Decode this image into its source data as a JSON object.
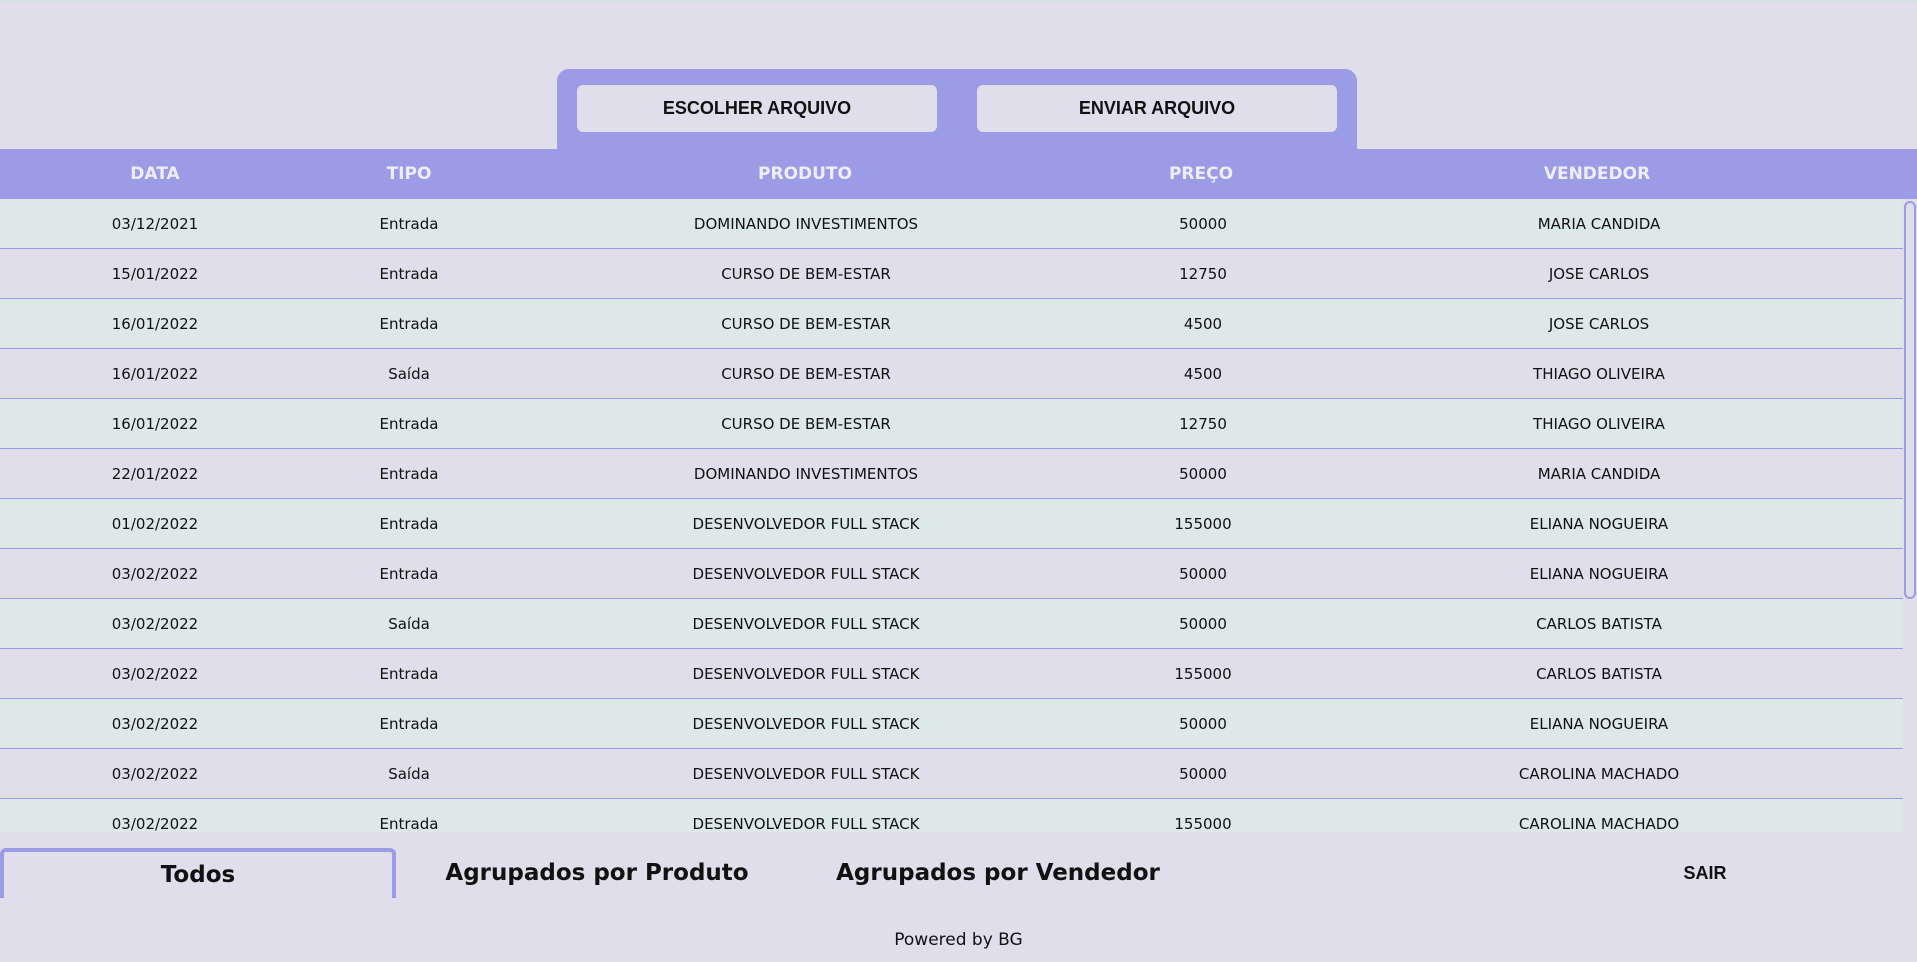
{
  "colors": {
    "background": "#dfdeea",
    "accent": "#9b9be6",
    "row_alt": "#dce9e8",
    "header_text": "#eeeef8"
  },
  "upload": {
    "choose_label": "ESCOLHER ARQUIVO",
    "send_label": "ENVIAR ARQUIVO"
  },
  "table": {
    "headers": {
      "data": "DATA",
      "tipo": "TIPO",
      "produto": "PRODUTO",
      "preco": "PREÇO",
      "vendedor": "VENDEDOR"
    },
    "rows": [
      {
        "data": "03/12/2021",
        "tipo": "Entrada",
        "produto": "DOMINANDO INVESTIMENTOS",
        "preco": "50000",
        "vendedor": "MARIA CANDIDA"
      },
      {
        "data": "15/01/2022",
        "tipo": "Entrada",
        "produto": "CURSO DE BEM-ESTAR",
        "preco": "12750",
        "vendedor": "JOSE CARLOS"
      },
      {
        "data": "16/01/2022",
        "tipo": "Entrada",
        "produto": "CURSO DE BEM-ESTAR",
        "preco": "4500",
        "vendedor": "JOSE CARLOS"
      },
      {
        "data": "16/01/2022",
        "tipo": "Saída",
        "produto": "CURSO DE BEM-ESTAR",
        "preco": "4500",
        "vendedor": "THIAGO OLIVEIRA"
      },
      {
        "data": "16/01/2022",
        "tipo": "Entrada",
        "produto": "CURSO DE BEM-ESTAR",
        "preco": "12750",
        "vendedor": "THIAGO OLIVEIRA"
      },
      {
        "data": "22/01/2022",
        "tipo": "Entrada",
        "produto": "DOMINANDO INVESTIMENTOS",
        "preco": "50000",
        "vendedor": "MARIA CANDIDA"
      },
      {
        "data": "01/02/2022",
        "tipo": "Entrada",
        "produto": "DESENVOLVEDOR FULL STACK",
        "preco": "155000",
        "vendedor": "ELIANA NOGUEIRA"
      },
      {
        "data": "03/02/2022",
        "tipo": "Entrada",
        "produto": "DESENVOLVEDOR FULL STACK",
        "preco": "50000",
        "vendedor": "ELIANA NOGUEIRA"
      },
      {
        "data": "03/02/2022",
        "tipo": "Saída",
        "produto": "DESENVOLVEDOR FULL STACK",
        "preco": "50000",
        "vendedor": "CARLOS BATISTA"
      },
      {
        "data": "03/02/2022",
        "tipo": "Entrada",
        "produto": "DESENVOLVEDOR FULL STACK",
        "preco": "155000",
        "vendedor": "CARLOS BATISTA"
      },
      {
        "data": "03/02/2022",
        "tipo": "Entrada",
        "produto": "DESENVOLVEDOR FULL STACK",
        "preco": "50000",
        "vendedor": "ELIANA NOGUEIRA"
      },
      {
        "data": "03/02/2022",
        "tipo": "Saída",
        "produto": "DESENVOLVEDOR FULL STACK",
        "preco": "50000",
        "vendedor": "CAROLINA MACHADO"
      },
      {
        "data": "03/02/2022",
        "tipo": "Entrada",
        "produto": "DESENVOLVEDOR FULL STACK",
        "preco": "155000",
        "vendedor": "CAROLINA MACHADO"
      }
    ]
  },
  "tabs": {
    "todos": "Todos",
    "por_produto": "Agrupados por Produto",
    "por_vendedor": "Agrupados por Vendedor"
  },
  "logout_label": "SAIR",
  "footer": "Powered by BG"
}
